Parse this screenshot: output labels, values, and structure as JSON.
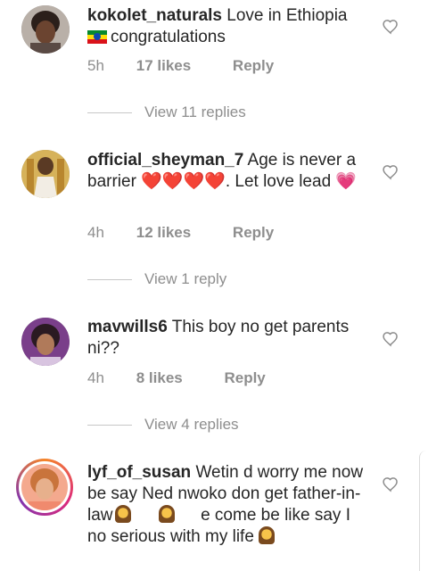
{
  "comments": [
    {
      "username": "kokolet_naturals",
      "text_before_emoji": "Love in Ethiopia",
      "flag_icon": "ethiopia-flag",
      "text_after_emoji": "congratulations",
      "time": "5h",
      "likes": "17 likes",
      "reply": "Reply",
      "view_replies": "View 11 replies"
    },
    {
      "username": "official_sheyman_7",
      "text_before_emoji": "Age is never a barrier",
      "hearts": "❤️❤️❤️❤️",
      "text_after_emoji": ". Let love lead",
      "sparkle_heart": "💗",
      "time": "4h",
      "likes": "12 likes",
      "reply": "Reply",
      "view_replies": "View 1 reply"
    },
    {
      "username": "mavwills6",
      "text": "This boy no get parents ni??",
      "time": "4h",
      "likes": "8 likes",
      "reply": "Reply",
      "view_replies": "View 4 replies"
    },
    {
      "username": "lyf_of_susan",
      "text_part1": "Wetin d worry me now be say Ned nwoko don get father-in-law",
      "text_part2": "e come be like say I no serious with my life",
      "person_icon": "woman-emoji"
    }
  ],
  "colors": {
    "text": "#262626",
    "muted": "#8e8e8e",
    "divider": "#c7c7c7"
  }
}
